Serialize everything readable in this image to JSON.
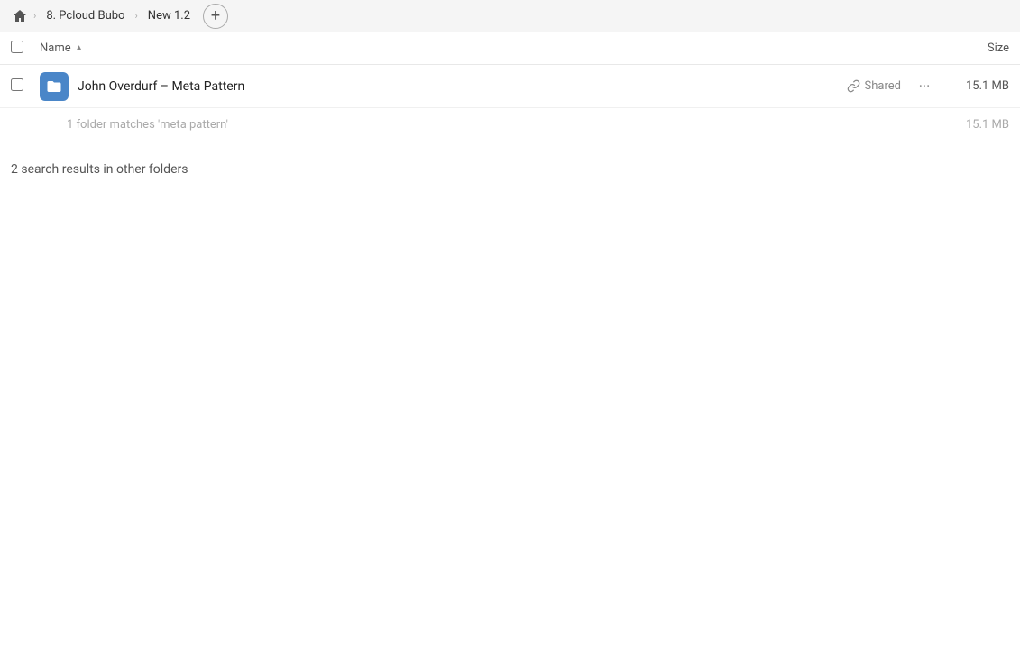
{
  "topbar": {
    "home_icon": "⌂",
    "breadcrumbs": [
      {
        "label": "8. Pcloud Bubo"
      },
      {
        "label": "New 1.2"
      }
    ],
    "add_icon": "+"
  },
  "column_headers": {
    "name_label": "Name",
    "sort_indicator": "▲",
    "size_label": "Size"
  },
  "file_row": {
    "name": "John Overdurf – Meta Pattern",
    "shared_label": "Shared",
    "size": "15.1 MB"
  },
  "summary": {
    "text": "1 folder matches 'meta pattern'",
    "size": "15.1 MB"
  },
  "other_folders": {
    "text": "2 search results in other folders"
  }
}
